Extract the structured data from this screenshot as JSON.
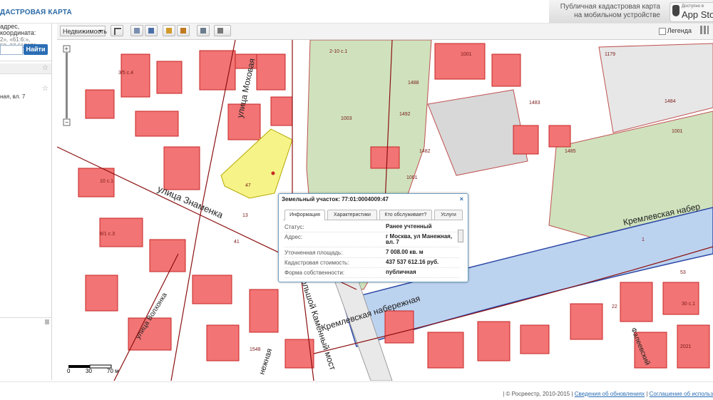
{
  "header": {
    "brand": "ДАСТРОВАЯ КАРТА",
    "promo": "Публичная кадастровая карта на мобильном устройстве",
    "appstore_small": "Доступно в",
    "appstore_big": "App Stor"
  },
  "sidebar": {
    "hint_line": "адрес, координата:",
    "hint_coords": "2», «61:6:»,",
    "hint_coords2": "58, 37.617671»",
    "search_placeholder": "",
    "search_button": "Найти",
    "result_text": "ная, вл. 7"
  },
  "toolbar": {
    "layer_select": "Недвижимость",
    "legend_label": "Легенда"
  },
  "map": {
    "street_labels": {
      "mokhovaya": "улица Моховая",
      "znamenka": "улица Знаменка",
      "volkhonka": "улица Волхонка",
      "kamenny_most": "Большой Каменный мост",
      "kremlevskaya_1": "Кремлевская набережная",
      "kremlevskaya_2": "Кремлевская набер",
      "prechistenskaya": "Фалеевский",
      "nezhnaya": "нежная"
    },
    "parcel_labels": [
      "2-10 с.1",
      "1001",
      "1179",
      "1003",
      "1488",
      "1492",
      "1482",
      "1483",
      "1484",
      "1485",
      "1001",
      "1001",
      "47",
      "41",
      "13",
      "1",
      "22",
      "3/5 с.4",
      "10 с.1",
      "8/1 с.3",
      "1548",
      "2021",
      "53",
      "30 с.1"
    ],
    "scale_labels": [
      "0",
      "30",
      "70 м"
    ],
    "colors": {
      "parcel": "#f27474",
      "parcel_edge": "#d42a2a",
      "selected": "#f6f388",
      "river": "#bcd3f0",
      "green": "#c9ddb6"
    }
  },
  "popup": {
    "title": "Земельный участок: 77:01:0004009:47",
    "close": "×",
    "tabs": [
      "Информация",
      "Характеристики",
      "Кто обслуживает?",
      "Услуги"
    ],
    "rows": [
      {
        "label": "Статус:",
        "value": "Ранее учтенный"
      },
      {
        "label": "Адрес:",
        "value": "г Москва, ул Манежная, вл. 7"
      },
      {
        "label": "Уточненная площадь:",
        "value": "7 008.00 кв. м"
      },
      {
        "label": "Кадастровая стоимость:",
        "value": "437 537 612.16 руб."
      },
      {
        "label": "Форма собственности:",
        "value": "публичная"
      }
    ]
  },
  "footer": {
    "copyright": "| © Росреестр, 2010-2015 |",
    "link1": "Сведения об обновлениях",
    "sep": "|",
    "link2": "Соглашение об использ"
  }
}
